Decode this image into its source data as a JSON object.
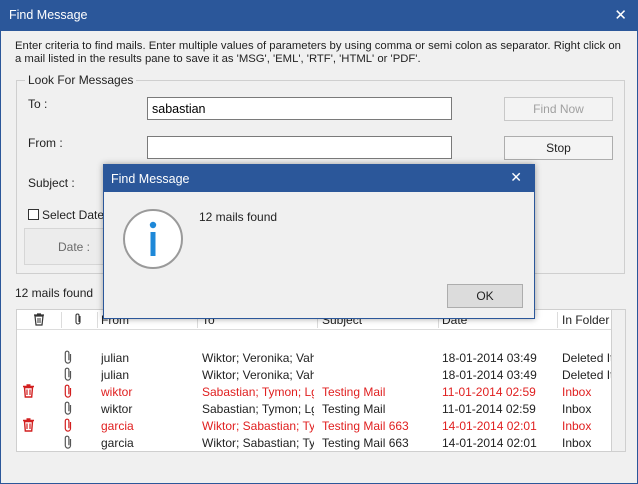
{
  "window": {
    "title": "Find Message",
    "close_glyph": "✕"
  },
  "instructions": "Enter criteria to find mails. Enter multiple values of parameters by using comma or semi colon as separator. Right click on a mail listed in the results pane to save it as 'MSG', 'EML', 'RTF', 'HTML' or 'PDF'.",
  "group": {
    "legend": "Look For Messages",
    "to_label": "To :",
    "to_value": "sabastian",
    "from_label": "From :",
    "from_value": "",
    "subject_label": "Subject :",
    "select_date_label": "Select Date R",
    "date_label": "Date :",
    "find_now": "Find Now",
    "stop": "Stop"
  },
  "results": {
    "count_label": "12 mails found",
    "columns": [
      "From",
      "To",
      "Subject",
      "Date",
      "In Folder"
    ],
    "rows": [
      {
        "deleted": false,
        "from": "julian",
        "to": "Wiktor; Veronika; Vah...",
        "subject": "",
        "date": "18-01-2014 03:49",
        "folder": "Deleted It"
      },
      {
        "deleted": false,
        "from": "julian",
        "to": "Wiktor; Veronika; Vah...",
        "subject": "",
        "date": "18-01-2014 03:49",
        "folder": "Deleted It"
      },
      {
        "deleted": true,
        "from": "wiktor",
        "to": "Sabastian; Tymon; Lg...",
        "subject": "Testing Mail",
        "date": "11-01-2014 02:59",
        "folder": "Inbox"
      },
      {
        "deleted": false,
        "from": "wiktor",
        "to": "Sabastian; Tymon; Lg...",
        "subject": "Testing Mail",
        "date": "11-01-2014 02:59",
        "folder": "Inbox"
      },
      {
        "deleted": true,
        "from": "garcia",
        "to": "Wiktor; Sabastian; Ty...",
        "subject": "Testing Mail 663",
        "date": "14-01-2014 02:01",
        "folder": "Inbox"
      },
      {
        "deleted": false,
        "from": "garcia",
        "to": "Wiktor; Sabastian; Ty...",
        "subject": "Testing Mail 663",
        "date": "14-01-2014 02:01",
        "folder": "Inbox"
      }
    ]
  },
  "dialog": {
    "title": "Find Message",
    "close_glyph": "✕",
    "message": "12 mails found",
    "ok": "OK",
    "icon": "info-icon"
  },
  "colors": {
    "titlebar": "#2b579a",
    "deleted_text": "#e02020",
    "info_blue": "#1e88d8"
  }
}
